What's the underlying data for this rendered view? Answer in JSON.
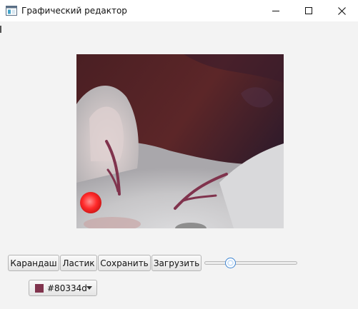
{
  "window": {
    "title": "Графический редактор",
    "controls": [
      "minimize-icon",
      "maximize-icon",
      "close-icon"
    ]
  },
  "toolbar": {
    "buttons": [
      {
        "label": "Карандаш"
      },
      {
        "label": "Ластик"
      },
      {
        "label": "Сохранить"
      },
      {
        "label": "Загрузить"
      }
    ],
    "brush_size_slider": {
      "value_fraction": 0.25
    }
  },
  "color_picker": {
    "value": "#80334d",
    "swatch_color": "#80334d",
    "arrow_icon": "chevron-down-icon"
  }
}
